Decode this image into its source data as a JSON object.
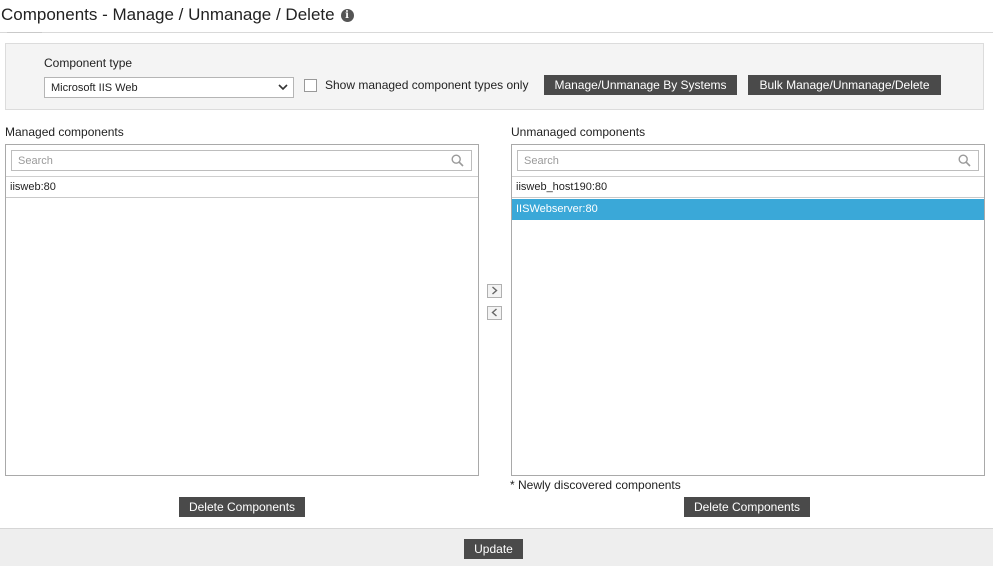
{
  "page": {
    "title": "Components - Manage / Unmanage / Delete",
    "info_icon": "info-icon"
  },
  "filter": {
    "component_type_label": "Component type",
    "component_type_value": "Microsoft IIS Web",
    "show_managed_label": "Show managed component types only",
    "show_managed_checked": false,
    "manage_by_systems_label": "Manage/Unmanage By Systems",
    "bulk_label": "Bulk Manage/Unmanage/Delete"
  },
  "managed": {
    "label": "Managed components",
    "search_placeholder": "Search",
    "items": [
      "iisweb:80"
    ],
    "delete_label": "Delete Components"
  },
  "unmanaged": {
    "label": "Unmanaged components",
    "search_placeholder": "Search",
    "items": [
      "iisweb_host190:80",
      "IISWebserver:80"
    ],
    "selected_index": 1,
    "note": "* Newly discovered components",
    "delete_label": "Delete Components"
  },
  "transfer": {
    "move_right_icon": "chevron-right-icon",
    "move_left_icon": "chevron-left-icon"
  },
  "footer": {
    "update_label": "Update"
  },
  "colors": {
    "selected_row": "#3aa8d8",
    "dark_button": "#4a4a4a",
    "panel_bg": "#f4f4f4"
  }
}
